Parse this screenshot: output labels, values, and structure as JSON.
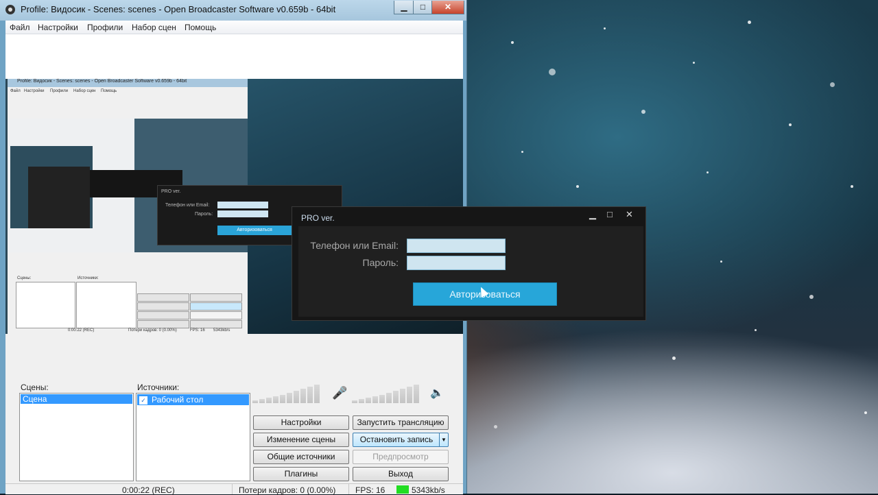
{
  "window": {
    "title": "Profile: Видосик - Scenes: scenes - Open Broadcaster Software v0.659b - 64bit",
    "minimize": "▁",
    "maximize": "□",
    "close": "✕"
  },
  "menu": [
    "Файл",
    "Настройки",
    "Профили",
    "Набор сцен",
    "Помощь"
  ],
  "scenes": {
    "label": "Сцены:",
    "items": [
      "Сцена"
    ]
  },
  "sources": {
    "label": "Источники:",
    "items": [
      "Рабочий стол"
    ]
  },
  "buttons": {
    "settings": "Настройки",
    "start_stream": "Запустить трансляцию",
    "edit_scene": "Изменение сцены",
    "stop_recording": "Остановить запись",
    "global_sources": "Общие источники",
    "preview": "Предпросмотр",
    "plugins": "Плагины",
    "exit": "Выход"
  },
  "status": {
    "time": "0:00:22 (REC)",
    "dropped_frames": "Потери кадров: 0 (0.00%)",
    "fps": "FPS: 16",
    "bitrate": "5343kb/s"
  },
  "nested": {
    "title": "Profile: Видосик - Scenes: scenes - Open Broadcaster Software v0.659b - 64bit",
    "menu": [
      "Файл",
      "Настройки",
      "Профили",
      "Набор сцен",
      "Помощь"
    ],
    "scenes_label": "Сцены:",
    "sources_label": "Источники:",
    "time": "0:00:22 (REC)",
    "dropped": "Потери кадров: 0 (0.00%)",
    "fps": "FPS: 16",
    "bitrate": "5343kb/s"
  },
  "dialog": {
    "title": "PRO ver.",
    "minimize": "▁",
    "maximize": "□",
    "close": "✕",
    "phone_label": "Телефон или Email:",
    "password_label": "Пароль:",
    "phone_value": "",
    "password_value": "",
    "submit": "Авторизоваться"
  },
  "colors": {
    "accent": "#27a6d9",
    "selection": "#3399ff",
    "bitrate_indicator": "#22dd22"
  }
}
